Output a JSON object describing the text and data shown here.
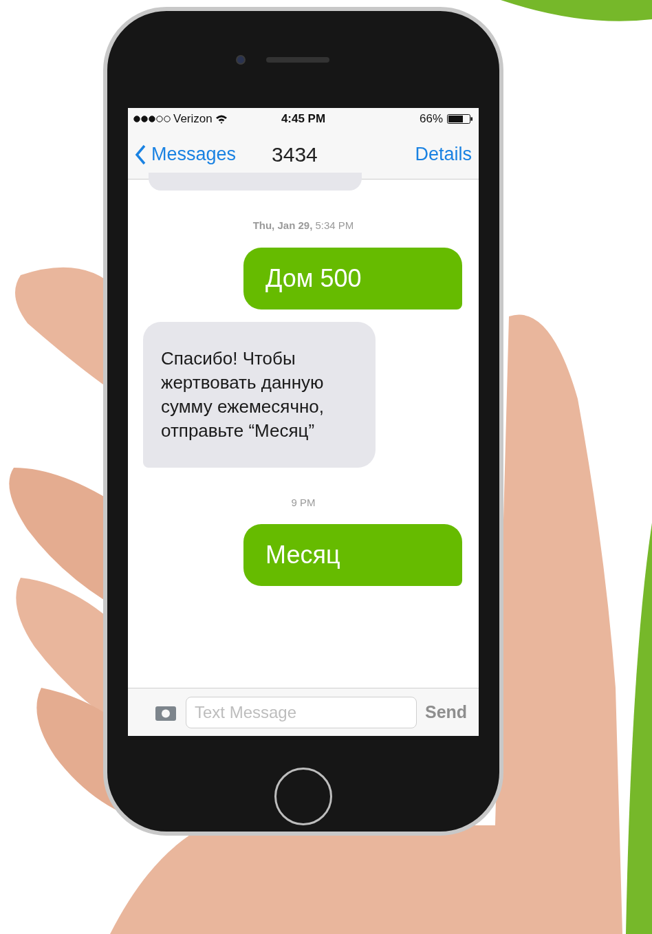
{
  "status_bar": {
    "carrier": "Verizon",
    "time": "4:45 PM",
    "battery": "66%"
  },
  "nav_bar": {
    "back": "Messages",
    "title": "3434",
    "action": "Details"
  },
  "messages": [
    {
      "kind": "received_cut"
    },
    {
      "kind": "timestamp",
      "text": "**Thu, Jan 29,** 5:34 PM"
    },
    {
      "kind": "sent",
      "text": "Дом 500"
    },
    {
      "kind": "received",
      "text": "Спасибо! Чтобы жертвовать данную сумму ежемесячно, отправьте “Месяц”"
    },
    {
      "kind": "timestamp",
      "text": "9 PM"
    },
    {
      "kind": "sent",
      "text": "Месяц"
    }
  ],
  "composer": {
    "placeholder": "Text Message",
    "send": "Send"
  }
}
